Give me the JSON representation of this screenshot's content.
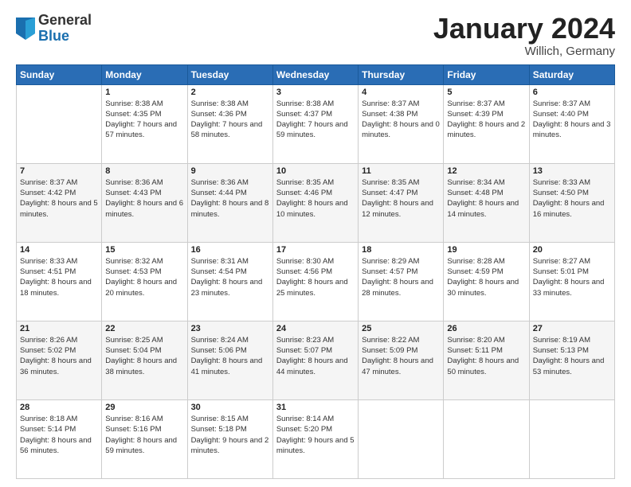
{
  "logo": {
    "general": "General",
    "blue": "Blue"
  },
  "title": {
    "month_year": "January 2024",
    "location": "Willich, Germany"
  },
  "days_of_week": [
    "Sunday",
    "Monday",
    "Tuesday",
    "Wednesday",
    "Thursday",
    "Friday",
    "Saturday"
  ],
  "weeks": [
    [
      {
        "day": "",
        "sunrise": "",
        "sunset": "",
        "daylight": ""
      },
      {
        "day": "1",
        "sunrise": "Sunrise: 8:38 AM",
        "sunset": "Sunset: 4:35 PM",
        "daylight": "Daylight: 7 hours and 57 minutes."
      },
      {
        "day": "2",
        "sunrise": "Sunrise: 8:38 AM",
        "sunset": "Sunset: 4:36 PM",
        "daylight": "Daylight: 7 hours and 58 minutes."
      },
      {
        "day": "3",
        "sunrise": "Sunrise: 8:38 AM",
        "sunset": "Sunset: 4:37 PM",
        "daylight": "Daylight: 7 hours and 59 minutes."
      },
      {
        "day": "4",
        "sunrise": "Sunrise: 8:37 AM",
        "sunset": "Sunset: 4:38 PM",
        "daylight": "Daylight: 8 hours and 0 minutes."
      },
      {
        "day": "5",
        "sunrise": "Sunrise: 8:37 AM",
        "sunset": "Sunset: 4:39 PM",
        "daylight": "Daylight: 8 hours and 2 minutes."
      },
      {
        "day": "6",
        "sunrise": "Sunrise: 8:37 AM",
        "sunset": "Sunset: 4:40 PM",
        "daylight": "Daylight: 8 hours and 3 minutes."
      }
    ],
    [
      {
        "day": "7",
        "sunrise": "Sunrise: 8:37 AM",
        "sunset": "Sunset: 4:42 PM",
        "daylight": "Daylight: 8 hours and 5 minutes."
      },
      {
        "day": "8",
        "sunrise": "Sunrise: 8:36 AM",
        "sunset": "Sunset: 4:43 PM",
        "daylight": "Daylight: 8 hours and 6 minutes."
      },
      {
        "day": "9",
        "sunrise": "Sunrise: 8:36 AM",
        "sunset": "Sunset: 4:44 PM",
        "daylight": "Daylight: 8 hours and 8 minutes."
      },
      {
        "day": "10",
        "sunrise": "Sunrise: 8:35 AM",
        "sunset": "Sunset: 4:46 PM",
        "daylight": "Daylight: 8 hours and 10 minutes."
      },
      {
        "day": "11",
        "sunrise": "Sunrise: 8:35 AM",
        "sunset": "Sunset: 4:47 PM",
        "daylight": "Daylight: 8 hours and 12 minutes."
      },
      {
        "day": "12",
        "sunrise": "Sunrise: 8:34 AM",
        "sunset": "Sunset: 4:48 PM",
        "daylight": "Daylight: 8 hours and 14 minutes."
      },
      {
        "day": "13",
        "sunrise": "Sunrise: 8:33 AM",
        "sunset": "Sunset: 4:50 PM",
        "daylight": "Daylight: 8 hours and 16 minutes."
      }
    ],
    [
      {
        "day": "14",
        "sunrise": "Sunrise: 8:33 AM",
        "sunset": "Sunset: 4:51 PM",
        "daylight": "Daylight: 8 hours and 18 minutes."
      },
      {
        "day": "15",
        "sunrise": "Sunrise: 8:32 AM",
        "sunset": "Sunset: 4:53 PM",
        "daylight": "Daylight: 8 hours and 20 minutes."
      },
      {
        "day": "16",
        "sunrise": "Sunrise: 8:31 AM",
        "sunset": "Sunset: 4:54 PM",
        "daylight": "Daylight: 8 hours and 23 minutes."
      },
      {
        "day": "17",
        "sunrise": "Sunrise: 8:30 AM",
        "sunset": "Sunset: 4:56 PM",
        "daylight": "Daylight: 8 hours and 25 minutes."
      },
      {
        "day": "18",
        "sunrise": "Sunrise: 8:29 AM",
        "sunset": "Sunset: 4:57 PM",
        "daylight": "Daylight: 8 hours and 28 minutes."
      },
      {
        "day": "19",
        "sunrise": "Sunrise: 8:28 AM",
        "sunset": "Sunset: 4:59 PM",
        "daylight": "Daylight: 8 hours and 30 minutes."
      },
      {
        "day": "20",
        "sunrise": "Sunrise: 8:27 AM",
        "sunset": "Sunset: 5:01 PM",
        "daylight": "Daylight: 8 hours and 33 minutes."
      }
    ],
    [
      {
        "day": "21",
        "sunrise": "Sunrise: 8:26 AM",
        "sunset": "Sunset: 5:02 PM",
        "daylight": "Daylight: 8 hours and 36 minutes."
      },
      {
        "day": "22",
        "sunrise": "Sunrise: 8:25 AM",
        "sunset": "Sunset: 5:04 PM",
        "daylight": "Daylight: 8 hours and 38 minutes."
      },
      {
        "day": "23",
        "sunrise": "Sunrise: 8:24 AM",
        "sunset": "Sunset: 5:06 PM",
        "daylight": "Daylight: 8 hours and 41 minutes."
      },
      {
        "day": "24",
        "sunrise": "Sunrise: 8:23 AM",
        "sunset": "Sunset: 5:07 PM",
        "daylight": "Daylight: 8 hours and 44 minutes."
      },
      {
        "day": "25",
        "sunrise": "Sunrise: 8:22 AM",
        "sunset": "Sunset: 5:09 PM",
        "daylight": "Daylight: 8 hours and 47 minutes."
      },
      {
        "day": "26",
        "sunrise": "Sunrise: 8:20 AM",
        "sunset": "Sunset: 5:11 PM",
        "daylight": "Daylight: 8 hours and 50 minutes."
      },
      {
        "day": "27",
        "sunrise": "Sunrise: 8:19 AM",
        "sunset": "Sunset: 5:13 PM",
        "daylight": "Daylight: 8 hours and 53 minutes."
      }
    ],
    [
      {
        "day": "28",
        "sunrise": "Sunrise: 8:18 AM",
        "sunset": "Sunset: 5:14 PM",
        "daylight": "Daylight: 8 hours and 56 minutes."
      },
      {
        "day": "29",
        "sunrise": "Sunrise: 8:16 AM",
        "sunset": "Sunset: 5:16 PM",
        "daylight": "Daylight: 8 hours and 59 minutes."
      },
      {
        "day": "30",
        "sunrise": "Sunrise: 8:15 AM",
        "sunset": "Sunset: 5:18 PM",
        "daylight": "Daylight: 9 hours and 2 minutes."
      },
      {
        "day": "31",
        "sunrise": "Sunrise: 8:14 AM",
        "sunset": "Sunset: 5:20 PM",
        "daylight": "Daylight: 9 hours and 5 minutes."
      },
      {
        "day": "",
        "sunrise": "",
        "sunset": "",
        "daylight": ""
      },
      {
        "day": "",
        "sunrise": "",
        "sunset": "",
        "daylight": ""
      },
      {
        "day": "",
        "sunrise": "",
        "sunset": "",
        "daylight": ""
      }
    ]
  ]
}
